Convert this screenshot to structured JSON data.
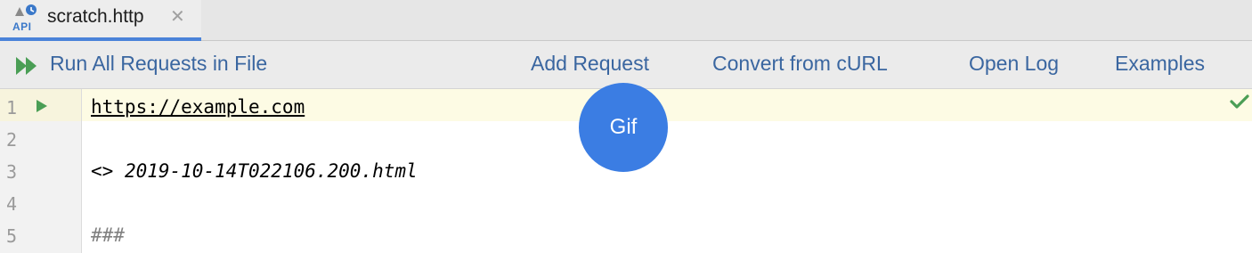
{
  "tab": {
    "icon_text": "API",
    "label": "scratch.http",
    "close_glyph": "✕"
  },
  "toolbar": {
    "run_all_label": "Run All Requests in File",
    "add_request_label": "Add Request",
    "convert_curl_label": "Convert from cURL",
    "open_log_label": "Open Log",
    "examples_label": "Examples"
  },
  "editor": {
    "lines": [
      {
        "number": "1",
        "text": "https://example.com"
      },
      {
        "number": "2",
        "text": ""
      },
      {
        "number": "3",
        "prefix": "<> ",
        "file": "2019-10-14T022106.200.html"
      },
      {
        "number": "4",
        "text": ""
      },
      {
        "number": "5",
        "text": "###"
      }
    ]
  },
  "overlay": {
    "label": "Gif"
  },
  "colors": {
    "accent": "#4a83d9",
    "link": "#3a66a0",
    "run_green": "#4a9e55",
    "badge": "#3b7de3"
  }
}
